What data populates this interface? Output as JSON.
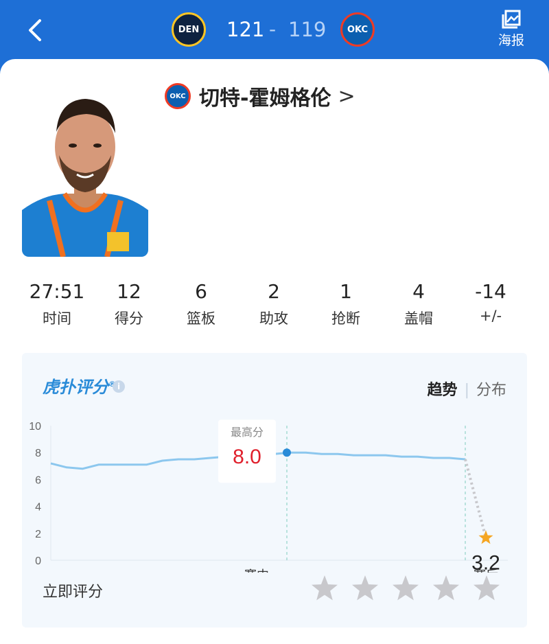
{
  "header": {
    "home_team": "DEN",
    "away_team": "OKC",
    "home_score": "121",
    "separator": "-",
    "away_score": "119",
    "poster_label": "海报"
  },
  "player": {
    "team": "OKC",
    "name": "切特-霍姆格伦",
    "arrow": ">"
  },
  "stats": [
    {
      "value": "27:51",
      "label": "时间"
    },
    {
      "value": "12",
      "label": "得分"
    },
    {
      "value": "6",
      "label": "篮板"
    },
    {
      "value": "2",
      "label": "助攻"
    },
    {
      "value": "1",
      "label": "抢断"
    },
    {
      "value": "4",
      "label": "盖帽"
    },
    {
      "value": "-14",
      "label": "+/-"
    }
  ],
  "rating": {
    "brand": "虎扑评分",
    "brand_mark": "®",
    "info_icon": "i",
    "tab_trend": "趋势",
    "tab_sep": "|",
    "tab_dist": "分布",
    "peak_label": "最高分",
    "peak_value": "8.0",
    "final_value": "3.2",
    "rate_now": "立即评分"
  },
  "colors": {
    "accent": "#1e6fd6",
    "line": "#8cc7ee",
    "peak": "#e0202c",
    "star_active": "#f5a623",
    "star_inactive": "#c8c8cc"
  },
  "chart_data": {
    "type": "line",
    "ylim": [
      0,
      10
    ],
    "yticks": [
      "0",
      "2",
      "4",
      "6",
      "8",
      "10"
    ],
    "x_labels": [
      "赛中",
      "赛后"
    ],
    "series": [
      {
        "values": [
          7.2,
          6.9,
          6.8,
          7.1,
          7.1,
          7.1,
          7.1,
          7.4,
          7.5,
          7.5,
          7.6,
          7.7,
          7.8,
          7.9,
          7.9,
          8.0,
          8.0,
          7.9,
          7.9,
          7.8,
          7.8,
          7.8,
          7.7,
          7.7,
          7.6,
          7.6,
          7.5
        ]
      }
    ],
    "peak": 8.0,
    "post_game": 3.2,
    "grid": false
  }
}
